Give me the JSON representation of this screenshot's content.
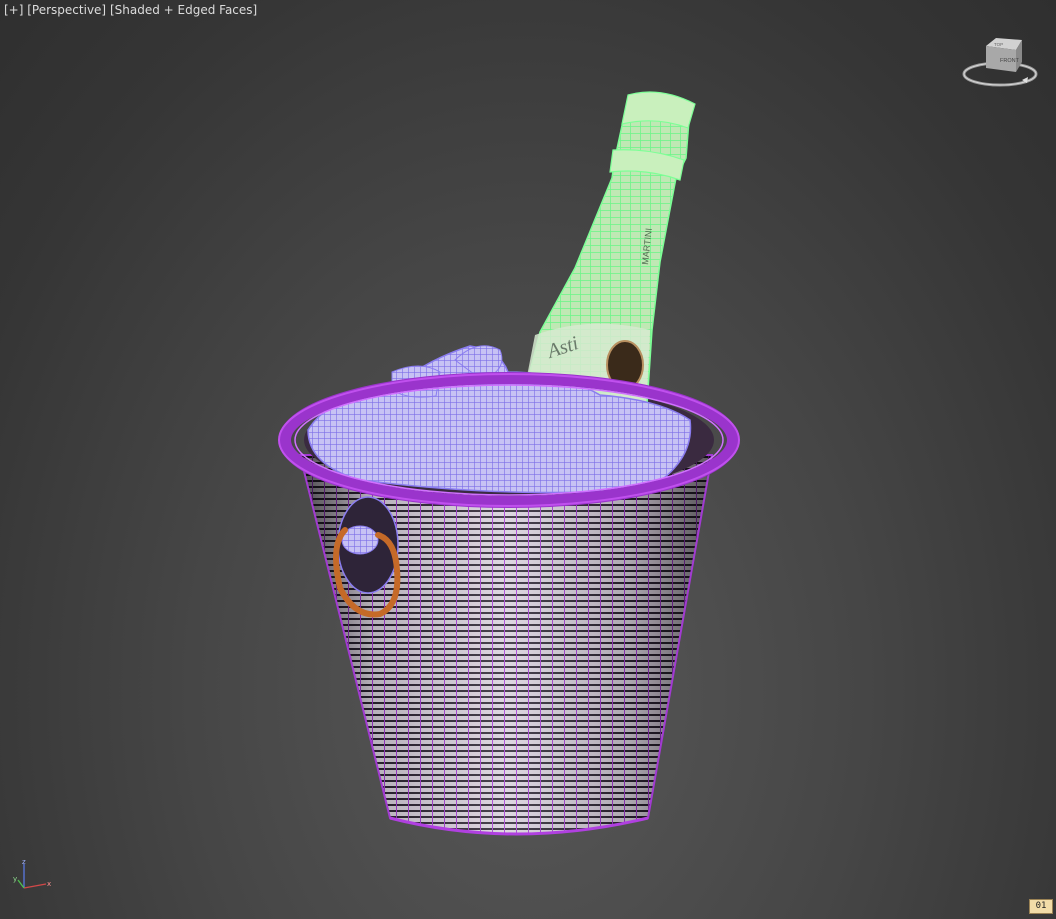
{
  "viewport": {
    "menu_label": "[+]",
    "view_label": "[Perspective]",
    "shading_label": "[Shaded + Edged Faces]"
  },
  "viewcube": {
    "face_label": "FRONT",
    "top_label": "TOP"
  },
  "axis": {
    "x": "x",
    "y": "y",
    "z": "z"
  },
  "frame_counter": "01",
  "bottle_label_text": "Asti",
  "bottle_brand_text": "MARTINI",
  "colors": {
    "bucket_wire": "#a23ad2",
    "bottle_wire": "#7dff96",
    "ice_wire": "#8a7cf0",
    "handle": "#c56a28"
  }
}
